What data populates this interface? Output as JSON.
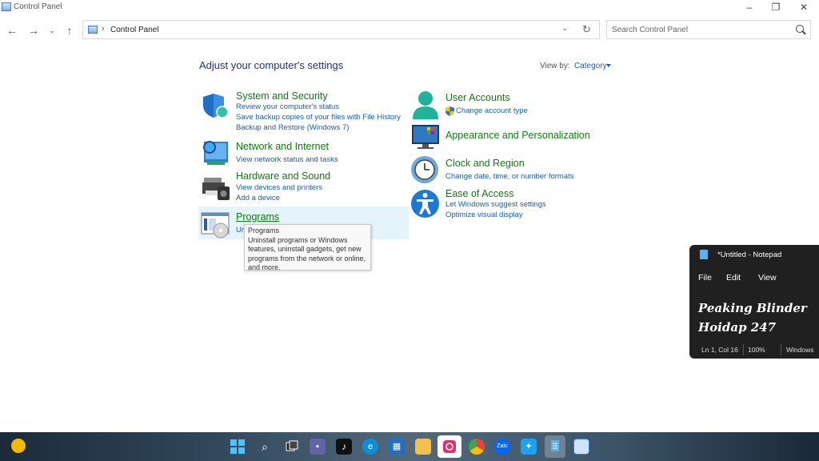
{
  "window": {
    "title": "Control Panel"
  },
  "address_bar": {
    "crumb": "Control Panel"
  },
  "search": {
    "placeholder": "Search Control Panel"
  },
  "main": {
    "heading": "Adjust your computer's settings",
    "view_by_label": "View by:",
    "view_by_value": "Category"
  },
  "categories": [
    {
      "title": "System and Security",
      "links": [
        "Review your computer's status",
        "Save backup copies of your files with File History",
        "Backup and Restore (Windows 7)"
      ]
    },
    {
      "title": "Network and Internet",
      "links": [
        "View network status and tasks"
      ]
    },
    {
      "title": "Hardware and Sound",
      "links": [
        "View devices and printers",
        "Add a device"
      ]
    },
    {
      "title": "Programs",
      "links": [
        "Un"
      ]
    },
    {
      "title": "User Accounts",
      "links": [
        "Change account type"
      ]
    },
    {
      "title": "Appearance and Personalization",
      "links": []
    },
    {
      "title": "Clock and Region",
      "links": [
        "Change date, time, or number formats"
      ]
    },
    {
      "title": "Ease of Access",
      "links": [
        "Let Windows suggest settings",
        "Optimize visual display"
      ]
    }
  ],
  "tooltip": {
    "title": "Programs",
    "lines": [
      "Uninstall programs or Windows",
      "features, uninstall gadgets, get new",
      "programs from the network or online,",
      "and more."
    ]
  },
  "notepad": {
    "title": "*Untitled - Notepad",
    "menu": [
      "File",
      "Edit",
      "View"
    ],
    "lines": [
      "Peaking Blinder",
      "Hoidap 247"
    ],
    "status": [
      "Ln 1, Col 16",
      "100%",
      "Windows"
    ]
  },
  "taskbar": {
    "icons": [
      "weather-icon",
      "start-icon",
      "search-icon",
      "task-view-icon",
      "teams-icon",
      "tiktok-icon",
      "edge-icon",
      "store-icon",
      "file-explorer-icon",
      "instagram-icon",
      "chrome-icon",
      "zalo-icon",
      "twitter-icon",
      "notepad-icon",
      "control-panel-icon"
    ],
    "zalo_label": "Zalo"
  },
  "colors": {
    "link": "#1a5fb4",
    "category_title": "#107c10",
    "heading": "#1e3287",
    "hover": "#e5f3fb"
  }
}
